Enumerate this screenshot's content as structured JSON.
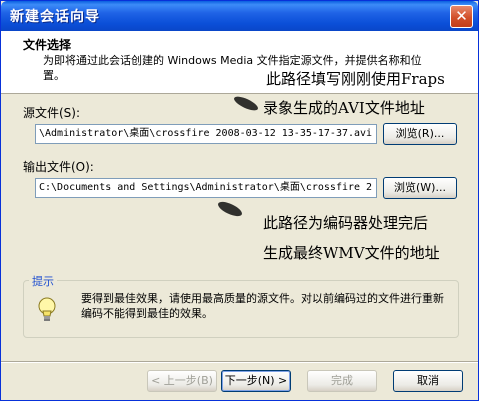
{
  "window": {
    "title": "新建会话向导",
    "close_symbol": "✕"
  },
  "header": {
    "title": "文件选择",
    "description": "为即将通过此会话创建的 Windows Media 文件指定源文件，并提供名称和位置。"
  },
  "source": {
    "label": "源文件(S):",
    "value": "\\Administrator\\桌面\\crossfire 2008-03-12 13-35-17-37.avi",
    "browse_label": "浏览(R)..."
  },
  "output": {
    "label": "输出文件(O):",
    "value": "C:\\Documents and Settings\\Administrator\\桌面\\crossfire 2",
    "browse_label": "浏览(W)..."
  },
  "annotations": {
    "line1": "此路径填写刚刚使用Fraps",
    "line2": "录象生成的AVI文件地址",
    "line3": "此路径为编码器处理完后",
    "line4": "生成最终WMV文件的地址"
  },
  "tips": {
    "title": "提示",
    "text": "要得到最佳效果，请使用最高质量的源文件。对以前编码过的文件进行重新编码不能得到最佳的效果。",
    "icon": "lightbulb-icon"
  },
  "footer": {
    "back_label": "< 上一步(B)",
    "next_label": "下一步(N) >",
    "finish_label": "完成",
    "cancel_label": "取消"
  }
}
